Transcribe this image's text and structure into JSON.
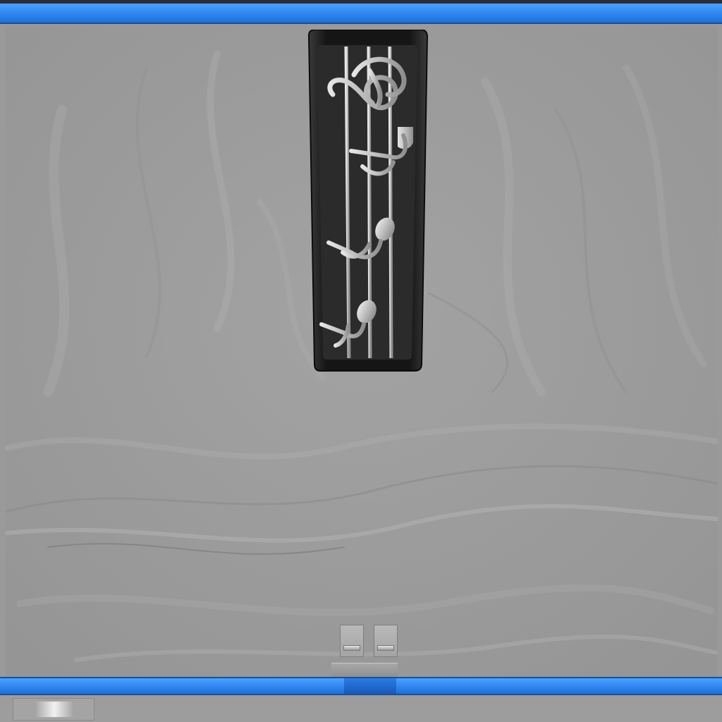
{
  "window": {
    "accent_color": "#2f86f0",
    "accent_dark": "#1a4f9a",
    "background_color": "#9b9b9b"
  },
  "plaque": {
    "icon": "music-notes-icon",
    "frame_color": "#1c1c1c",
    "inset_color": "#2b2b2b",
    "metal_color": "#c4c4c4",
    "symbols": [
      "treble-clef-icon",
      "eighth-note-icon",
      "eighth-note-icon",
      "eighth-note-icon"
    ]
  },
  "controls": {
    "pedals": [
      "pedal-left",
      "pedal-right"
    ],
    "scroll_thumb_icon": "scroll-thumb"
  }
}
